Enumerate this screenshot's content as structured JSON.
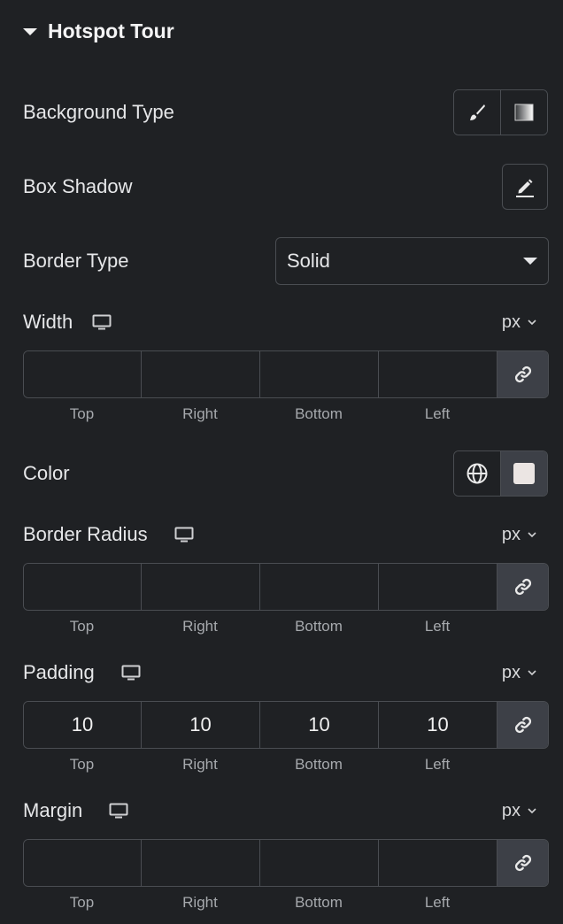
{
  "section": {
    "title": "Hotspot Tour"
  },
  "controls": {
    "background_type": {
      "label": "Background Type"
    },
    "box_shadow": {
      "label": "Box Shadow"
    },
    "border_type": {
      "label": "Border Type",
      "value": "Solid"
    },
    "width": {
      "label": "Width",
      "unit": "px",
      "values": [
        "",
        "",
        "",
        ""
      ],
      "sides": [
        "Top",
        "Right",
        "Bottom",
        "Left"
      ]
    },
    "color": {
      "label": "Color",
      "swatch": "#ebe5e3"
    },
    "border_radius": {
      "label": "Border Radius",
      "unit": "px",
      "values": [
        "",
        "",
        "",
        ""
      ],
      "sides": [
        "Top",
        "Right",
        "Bottom",
        "Left"
      ]
    },
    "padding": {
      "label": "Padding",
      "unit": "px",
      "values": [
        "10",
        "10",
        "10",
        "10"
      ],
      "sides": [
        "Top",
        "Right",
        "Bottom",
        "Left"
      ]
    },
    "margin": {
      "label": "Margin",
      "unit": "px",
      "values": [
        "",
        "",
        "",
        ""
      ],
      "sides": [
        "Top",
        "Right",
        "Bottom",
        "Left"
      ]
    }
  },
  "colors": {
    "background": "#1f2124",
    "active_button": "#3d4047",
    "border": "#4a4d52"
  }
}
